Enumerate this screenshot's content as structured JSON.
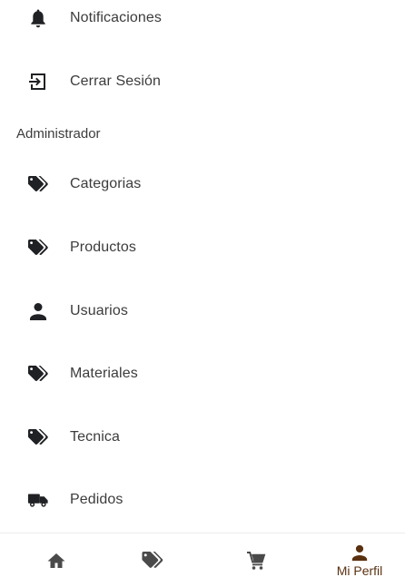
{
  "menu": {
    "items": [
      {
        "label": "Notificaciones",
        "icon": "bell-icon"
      },
      {
        "label": "Cerrar Sesión",
        "icon": "logout-icon"
      }
    ],
    "section_title": "Administrador",
    "admin_items": [
      {
        "label": "Categorias",
        "icon": "tag-icon"
      },
      {
        "label": "Productos",
        "icon": "tag-icon"
      },
      {
        "label": "Usuarios",
        "icon": "person-icon"
      },
      {
        "label": "Materiales",
        "icon": "tag-icon"
      },
      {
        "label": "Tecnica",
        "icon": "tag-icon"
      },
      {
        "label": "Pedidos",
        "icon": "truck-icon"
      }
    ]
  },
  "bottom_nav": {
    "items": [
      {
        "icon": "home-icon",
        "label": ""
      },
      {
        "icon": "tag-icon",
        "label": ""
      },
      {
        "icon": "cart-icon",
        "label": ""
      },
      {
        "icon": "person-icon",
        "label": "Mi Perfil",
        "active": true
      }
    ]
  },
  "colors": {
    "icon": "#202124",
    "text": "#3c3c3c",
    "active_accent": "#5a3110"
  }
}
